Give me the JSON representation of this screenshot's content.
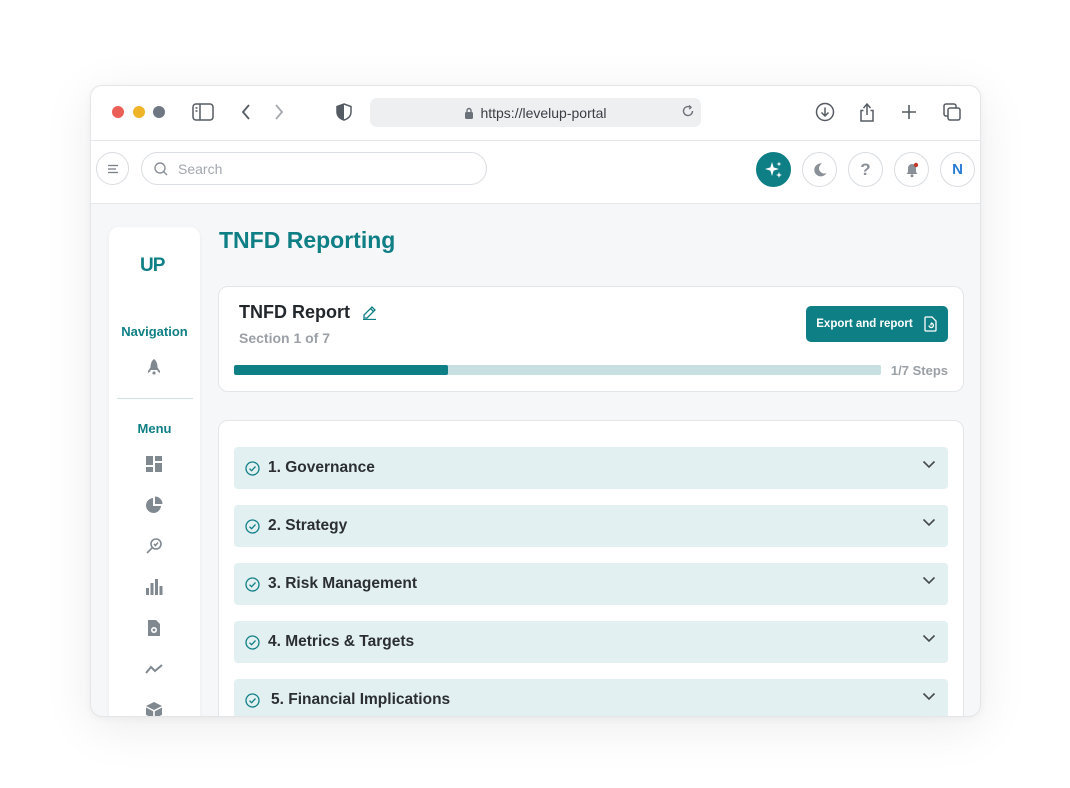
{
  "browser": {
    "url": "https://levelup-portal"
  },
  "header": {
    "search_placeholder": "Search",
    "avatar_initial": "N"
  },
  "sidebar": {
    "logo": "UP",
    "navigation_label": "Navigation",
    "menu_label": "Menu"
  },
  "page": {
    "title": "TNFD Reporting"
  },
  "report": {
    "title": "TNFD Report",
    "section_indicator": "Section 1 of 7",
    "export_label": "Export and report",
    "progress_label": "1/7 Steps",
    "progress_fraction": 0.33
  },
  "sections": [
    {
      "label": "1. Governance"
    },
    {
      "label": "2. Strategy"
    },
    {
      "label": "3. Risk Management"
    },
    {
      "label": "4. Metrics & Targets"
    },
    {
      "label": "5. Financial Implications"
    }
  ],
  "colors": {
    "accent": "#0f7f86",
    "section_bg": "#e3f0f1",
    "progress_track": "#c8dfe1",
    "notification_dot": "#c0392b"
  }
}
